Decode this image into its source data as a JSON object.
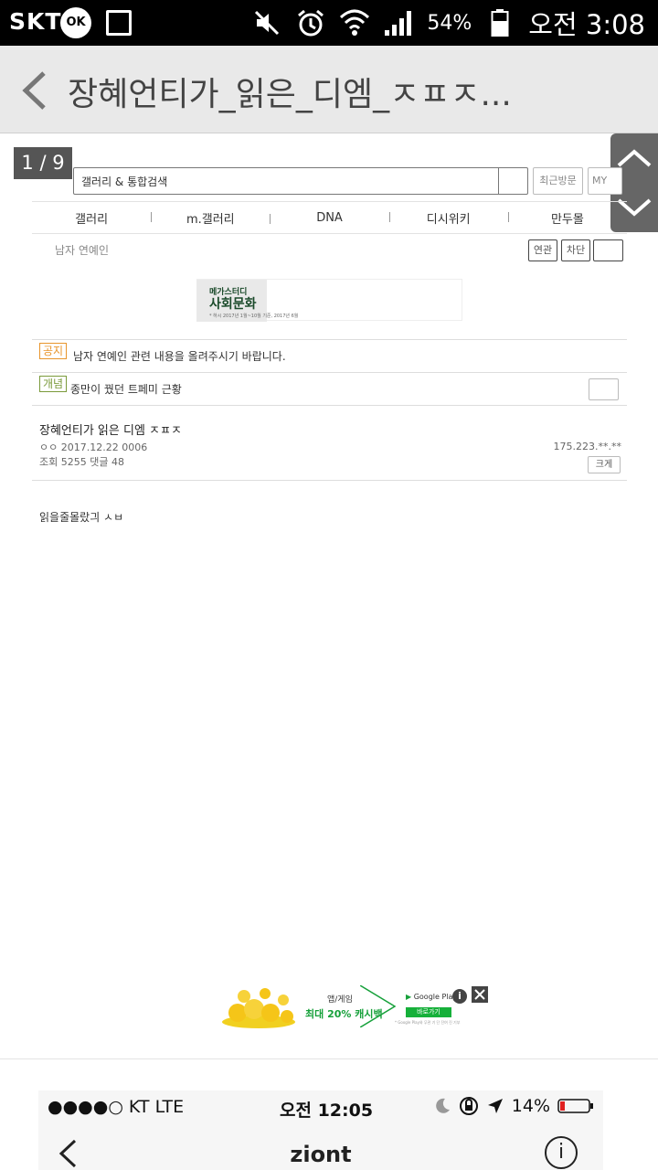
{
  "status_bar": {
    "carrier": "SKT",
    "ok_badge": "OK",
    "battery": "54%",
    "time": "오전 3:08"
  },
  "header": {
    "title": "장혜언티가_읽은_디엠_ㅈㅍㅈ..."
  },
  "page_counter": "1 / 9",
  "search": {
    "placeholder": "갤러리 & 통합검색",
    "recent_label": "최근방문",
    "my_label": "MY"
  },
  "nav": {
    "items": [
      "갤러리",
      "m.갤러리",
      "DNA",
      "디시위키",
      "만두몰"
    ]
  },
  "gallery": {
    "name": "남자 연예인",
    "related_label": "연관",
    "block_label": "차단"
  },
  "banner": {
    "line1": "메가스터디",
    "line2": "사회문화",
    "line3": "* 하시 2017년 1월~10월 기준, 2017년 6월"
  },
  "notice": {
    "tag": "공지",
    "text": "남자 연예인 관련 내용을 올려주시기 바랍니다."
  },
  "concept": {
    "tag": "개념",
    "text": "종만이 꿨던 트페미 근황"
  },
  "post": {
    "title": "장혜언티가 읽은 디엠 ㅈㅍㅈ",
    "author_date": "ㅇㅇ 2017.12.22 0006",
    "stats": "조회 5255  댓글  48",
    "ip": "175.223.**.**",
    "size_label": "크게",
    "body": "읽을줄몰랐긔 ㅅㅂ"
  },
  "ad": {
    "line1": "앱/게임",
    "line2": "최대 20% 캐시백",
    "store": "Google Play",
    "cta": "바로가기",
    "fine": "* Google Play와 무관 기 단 잔여 진 기부"
  },
  "embedded_ios": {
    "carrier": "●●●●○ KT   LTE",
    "time": "오전 12:05",
    "battery": "14%",
    "nav_title": "ziont",
    "info_symbol": "i"
  },
  "colors": {
    "tag_notice": "#e8952b",
    "tag_concept": "#7a9a3a",
    "ad_green": "#16a03a",
    "battery_low": "#e02020"
  }
}
